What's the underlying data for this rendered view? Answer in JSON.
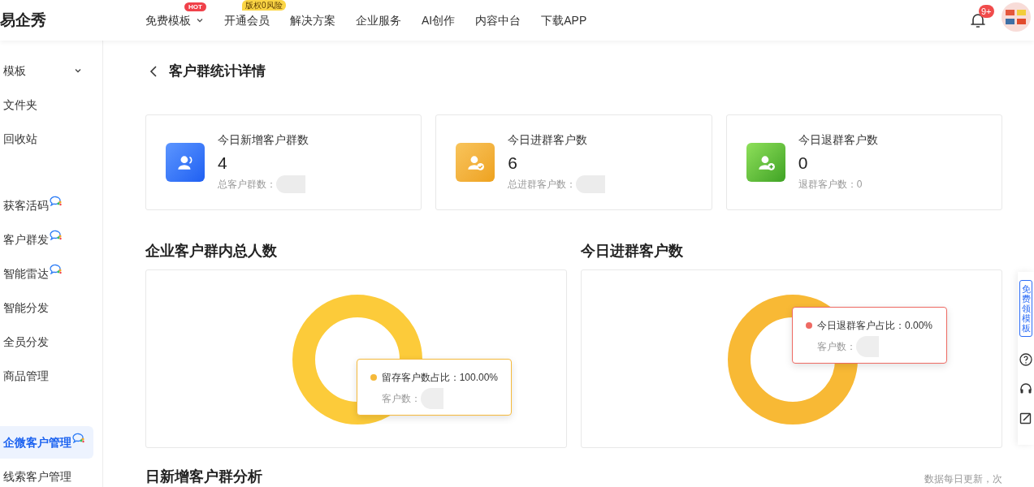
{
  "header": {
    "logo": "易企秀",
    "nav": [
      {
        "label": "免费模板",
        "badge": "HOT",
        "color": "#f0414a",
        "dropdown": true
      },
      {
        "label": "开通会员",
        "badge": "版权0风险",
        "color": "#fbd545",
        "dropdown": false
      },
      {
        "label": "解决方案",
        "dropdown": false
      },
      {
        "label": "企业服务",
        "dropdown": false
      },
      {
        "label": "AI创作",
        "dropdown": false
      },
      {
        "label": "内容中台",
        "dropdown": false
      },
      {
        "label": "下载APP",
        "dropdown": false
      }
    ],
    "notification_count": "9+"
  },
  "sidebar": {
    "groups": [
      {
        "items": [
          {
            "label": "模板",
            "selected": false,
            "expandable": true,
            "wecom": false
          },
          {
            "label": "文件夹",
            "selected": false,
            "expandable": false,
            "wecom": false
          },
          {
            "label": "回收站",
            "selected": false,
            "expandable": false,
            "wecom": false
          }
        ]
      },
      {
        "items": [
          {
            "label": "获客活码",
            "selected": false,
            "expandable": false,
            "wecom": true
          },
          {
            "label": "客户群发",
            "selected": false,
            "expandable": false,
            "wecom": true
          },
          {
            "label": "智能雷达",
            "selected": false,
            "expandable": false,
            "wecom": true
          },
          {
            "label": "智能分发",
            "selected": false,
            "expandable": false,
            "wecom": false
          },
          {
            "label": "全员分发",
            "selected": false,
            "expandable": false,
            "wecom": false
          },
          {
            "label": "商品管理",
            "selected": false,
            "expandable": false,
            "wecom": false
          }
        ]
      },
      {
        "items": [
          {
            "label": "企微客户管理",
            "selected": true,
            "expandable": false,
            "wecom": true
          },
          {
            "label": "线索客户管理",
            "selected": false,
            "expandable": false,
            "wecom": false
          }
        ]
      }
    ]
  },
  "page": {
    "title": "客户群统计详情"
  },
  "stats": [
    {
      "kind": "group",
      "title": "今日新增客户群数",
      "value": "4",
      "sub_label": "总客户群数：",
      "redacted": true
    },
    {
      "kind": "check",
      "title": "今日进群客户数",
      "value": "6",
      "sub_label": "总进群客户数：",
      "redacted": true
    },
    {
      "kind": "add",
      "title": "今日退群客户数",
      "value": "0",
      "sub_label": "退群客户数：0",
      "redacted": false
    }
  ],
  "charts": [
    {
      "title": "企业客户群内总人数",
      "tooltip": {
        "label": "留存客户数占比：100.00%",
        "sub_label": "客户数：",
        "color": "#f5b93a"
      }
    },
    {
      "title": "今日进群客户数",
      "tooltip": {
        "label": "今日退群客户占比：0.00%",
        "sub_label": "客户数：",
        "color": "#ee6a63"
      }
    }
  ],
  "next_section": {
    "title": "日新增客户群分析",
    "note": "数据每日更新，次"
  },
  "side_panel": {
    "promo": "免费领模板"
  }
}
